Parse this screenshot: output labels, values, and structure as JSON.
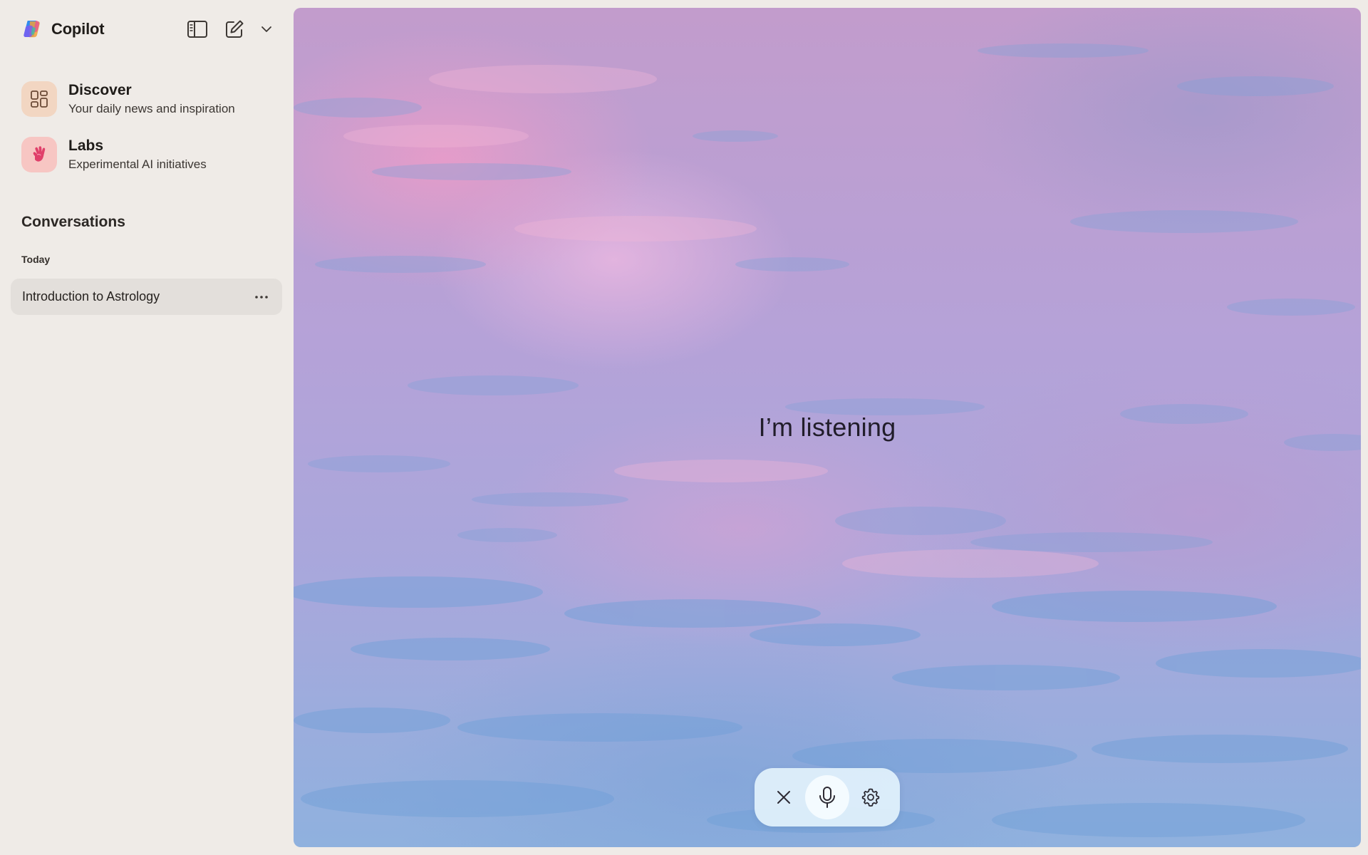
{
  "app": {
    "name": "Copilot"
  },
  "toolbar": {
    "sidebar_toggle_icon": "sidebar-toggle-icon",
    "new_chat_icon": "compose-icon",
    "dropdown_icon": "chevron-down-icon"
  },
  "sidebar": {
    "nav": [
      {
        "title": "Discover",
        "subtitle": "Your daily news and inspiration",
        "icon": "grid-icon"
      },
      {
        "title": "Labs",
        "subtitle": "Experimental AI initiatives",
        "icon": "hand-icon"
      }
    ],
    "conversations_title": "Conversations",
    "groups": [
      {
        "label": "Today",
        "items": [
          {
            "title": "Introduction to Astrology",
            "more_icon": "more-horizontal-icon"
          }
        ]
      }
    ]
  },
  "voice": {
    "status": "I’m listening",
    "controls": [
      {
        "name": "close",
        "icon": "close-icon"
      },
      {
        "name": "microphone",
        "icon": "microphone-icon"
      },
      {
        "name": "settings",
        "icon": "gear-icon"
      }
    ]
  },
  "colors": {
    "sidebar_bg": "#efebe7",
    "active_item_bg": "#e3dfdb",
    "discover_icon_bg": "#f2d6c2",
    "labs_icon_bg": "#f7c6c3",
    "controls_bg": "#e2f2fc"
  }
}
